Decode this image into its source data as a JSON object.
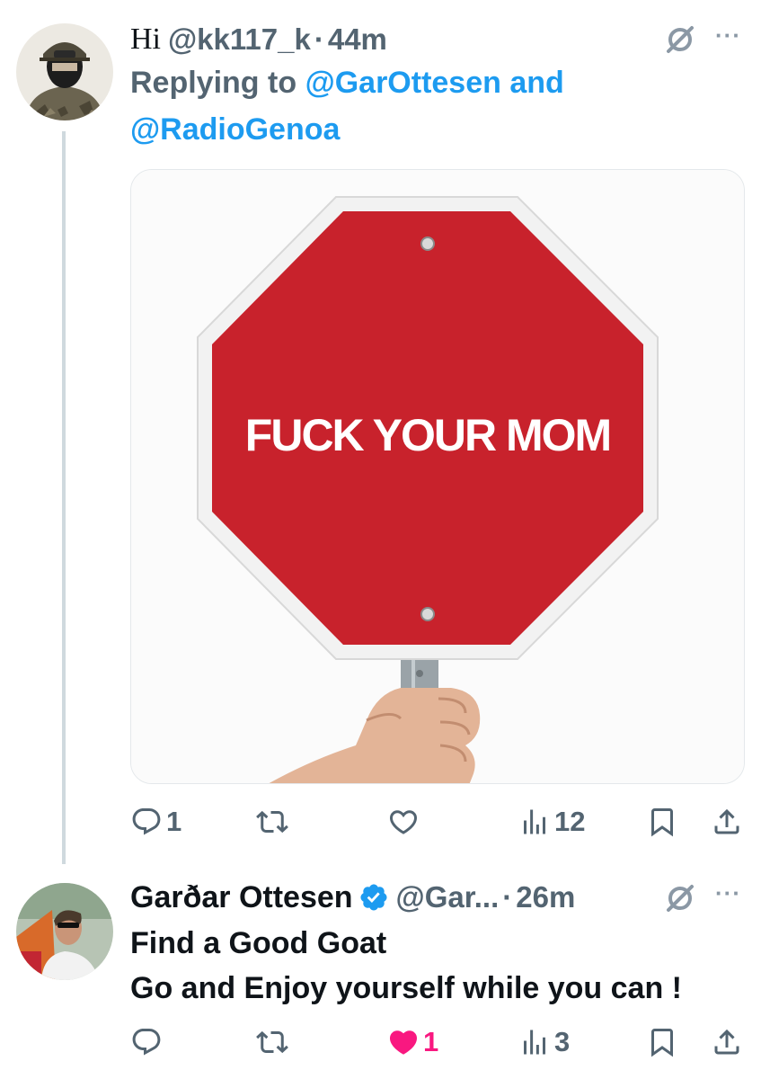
{
  "tweet1": {
    "display_name": "Hi",
    "handle": "@kk117_k",
    "separator": "·",
    "time": "44m",
    "replying_prefix": "Replying to",
    "mention1": "@GarOttesen",
    "conjunction": "and",
    "mention2": "@RadioGenoa",
    "image_sign_text": "FUCK YOUR MOM",
    "actions": {
      "reply_count": "1",
      "retweet_count": "",
      "like_count": "",
      "views_count": "12"
    }
  },
  "tweet2": {
    "display_name": "Garðar Ottesen",
    "verified": true,
    "handle": "@Gar...",
    "separator": "·",
    "time": "26m",
    "text_line1": "Find a Good Goat",
    "text_line2": "Go and Enjoy yourself while you can !",
    "actions": {
      "reply_count": "",
      "retweet_count": "",
      "like_count": "1",
      "liked": true,
      "views_count": "3"
    }
  },
  "colors": {
    "accent": "#1d9bf0",
    "muted": "#536471",
    "like_active": "#f91880",
    "sign_red": "#c8222c"
  }
}
